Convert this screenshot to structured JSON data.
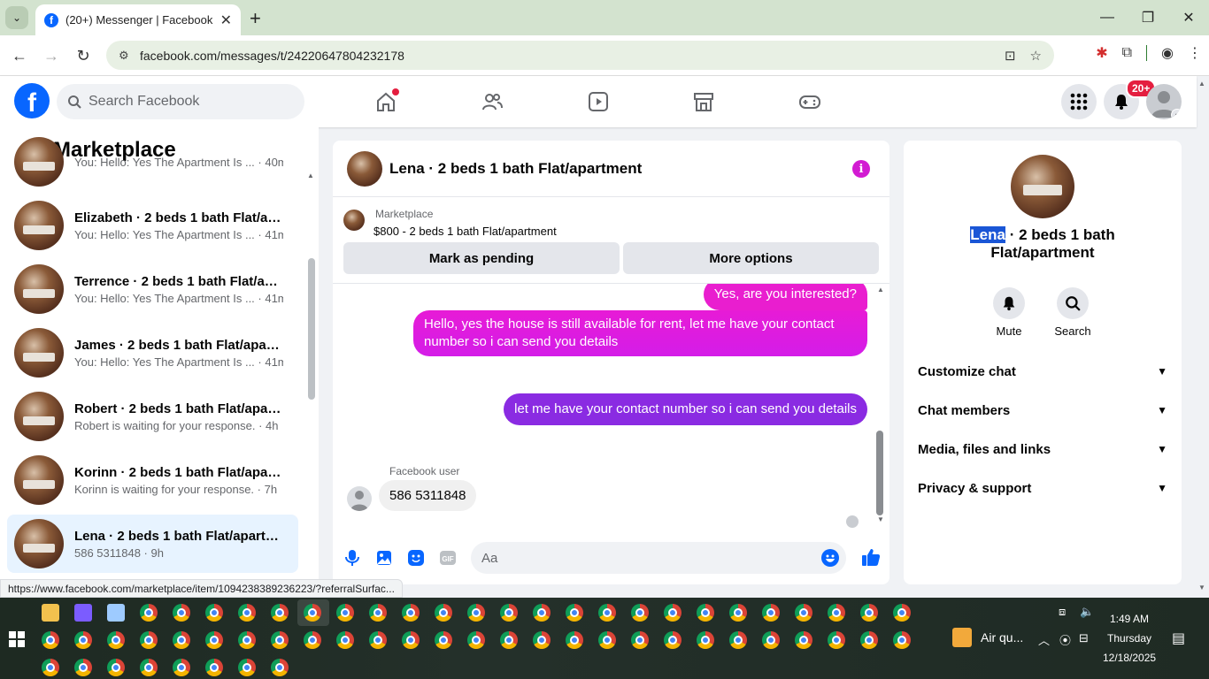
{
  "browser": {
    "tab_title": "(20+) Messenger | Facebook",
    "url": "facebook.com/messages/t/24220647804232178",
    "status_url": "https://www.facebook.com/marketplace/item/1094238389236223/?referralSurfac..."
  },
  "header": {
    "search_placeholder": "Search Facebook",
    "notification_badge": "20+"
  },
  "left_panel": {
    "title": "Marketplace",
    "conversations": [
      {
        "name": "",
        "preview": "You: Hello: Yes The Apartment Is ... · 40m"
      },
      {
        "name": "Elizabeth · 2 beds 1 bath Flat/ap...",
        "preview": "You: Hello: Yes The Apartment Is ... · 41m"
      },
      {
        "name": "Terrence · 2 beds 1 bath Flat/apa...",
        "preview": "You: Hello: Yes The Apartment Is ... · 41m"
      },
      {
        "name": "James · 2 beds 1 bath Flat/apart...",
        "preview": "You: Hello: Yes The Apartment Is ... · 41m"
      },
      {
        "name": "Robert · 2 beds 1 bath Flat/apart...",
        "preview": "Robert is waiting for your response. · 4h"
      },
      {
        "name": "Korinn · 2 beds 1 bath Flat/apart...",
        "preview": "Korinn is waiting for your response. · 7h"
      },
      {
        "name": "Lena · 2 beds 1 bath Flat/apartm...",
        "preview": "586 5311848 · 9h"
      }
    ]
  },
  "chat": {
    "title": "Lena · 2 beds 1 bath Flat/apartment",
    "marketplace_label": "Marketplace",
    "listing": "$800 - 2 beds 1 bath Flat/apartment",
    "mark_pending": "Mark as pending",
    "more_options": "More options",
    "messages": [
      "Yes, are you interested?",
      "Hello, yes the house is still available for rent, let me have your contact number so i can send you details",
      "let me have your contact number so i can send you details"
    ],
    "sender_name": "Facebook user",
    "incoming": "586 5311848",
    "composer_placeholder": "Aa",
    "colors": {
      "pink": "#e91ecf",
      "purple": "#8a2be2",
      "accent": "#0866ff"
    }
  },
  "right_panel": {
    "title_highlight": "Lena",
    "title_rest": " · 2 beds 1 bath Flat/apartment",
    "mute": "Mute",
    "search": "Search",
    "sections": [
      "Customize chat",
      "Chat members",
      "Media, files and links",
      "Privacy & support"
    ]
  },
  "taskbar": {
    "weather": "Air qu...",
    "time": "1:49 AM",
    "day": "Thursday",
    "date": "12/18/2025"
  }
}
